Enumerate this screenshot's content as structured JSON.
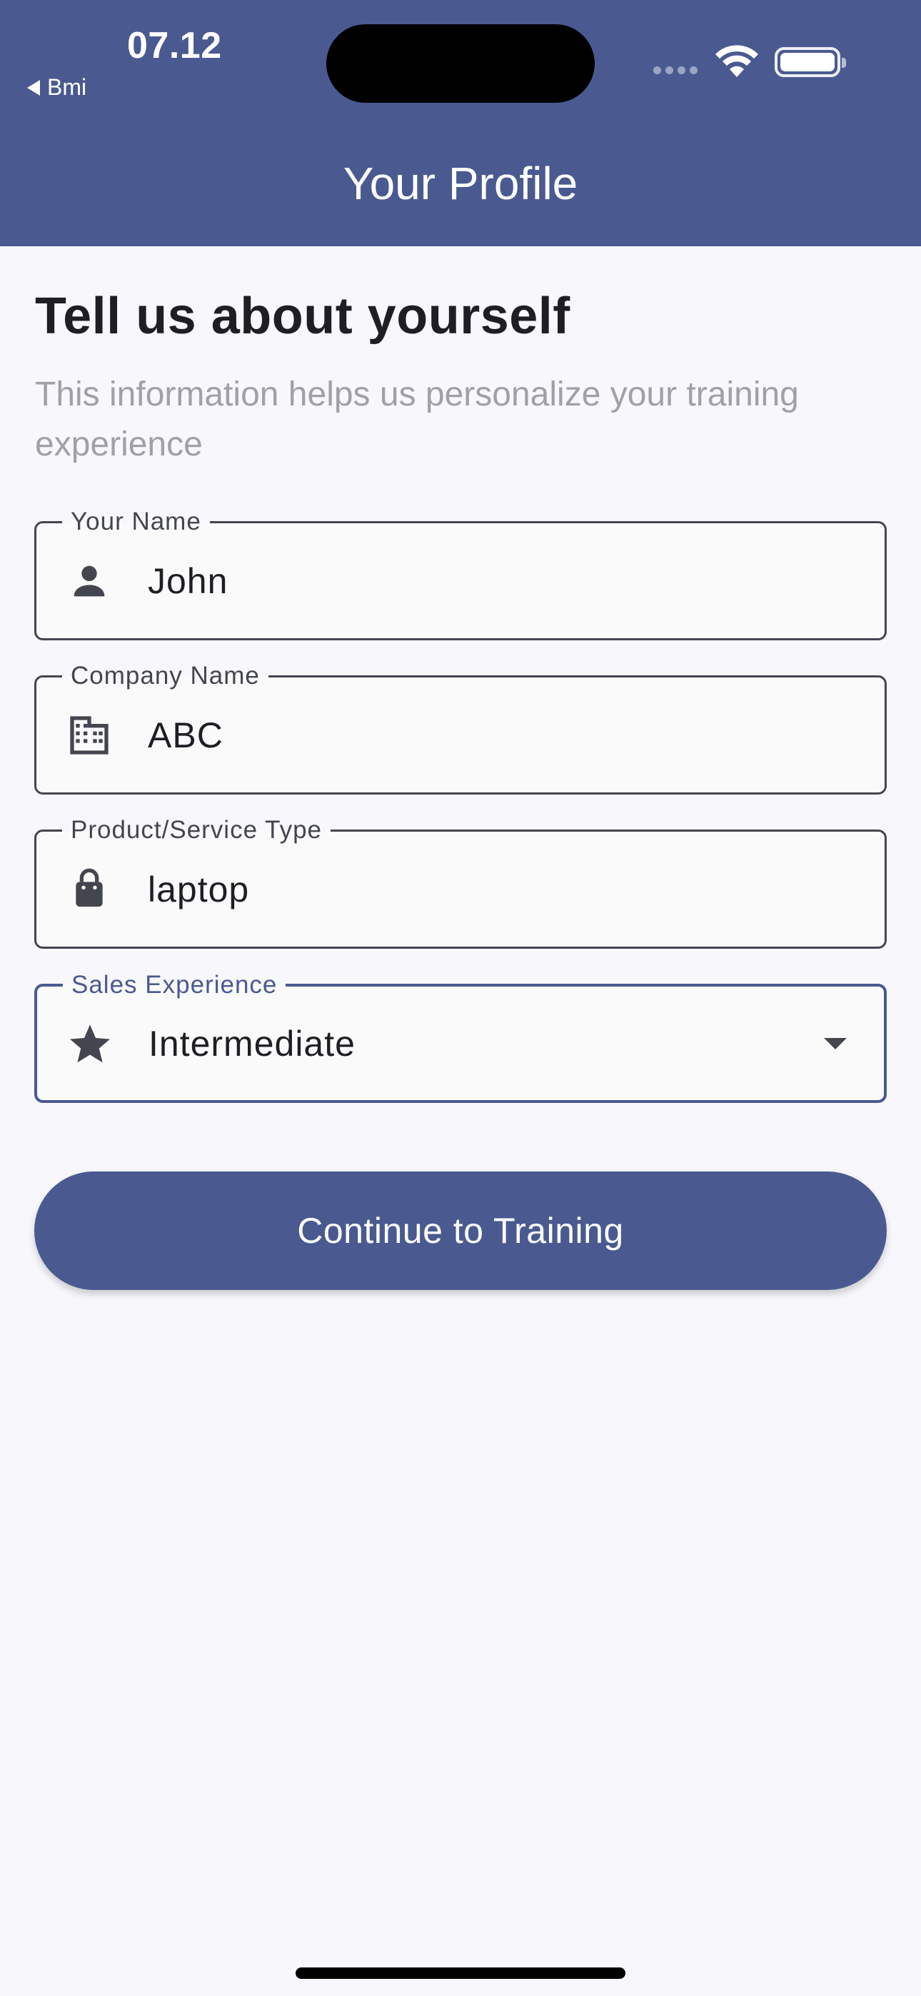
{
  "status_bar": {
    "time": "07.12",
    "back_app": "Bmi"
  },
  "header": {
    "title": "Your Profile"
  },
  "intro": {
    "heading": "Tell us about yourself",
    "subtitle": "This information helps us personalize your training experience"
  },
  "fields": [
    {
      "label": "Your Name",
      "value": "John",
      "icon": "person-icon"
    },
    {
      "label": "Company Name",
      "value": "ABC",
      "icon": "building-icon"
    },
    {
      "label": "Product/Service Type",
      "value": "laptop",
      "icon": "shopping-bag-icon"
    },
    {
      "label": "Sales Experience",
      "value": "Intermediate",
      "icon": "star-icon",
      "type": "dropdown"
    }
  ],
  "actions": {
    "continue_label": "Continue to Training"
  },
  "colors": {
    "primary": "#4A5A91",
    "background": "#F7F7FC",
    "text": "#1E1E24",
    "muted": "#A0A0A6"
  }
}
